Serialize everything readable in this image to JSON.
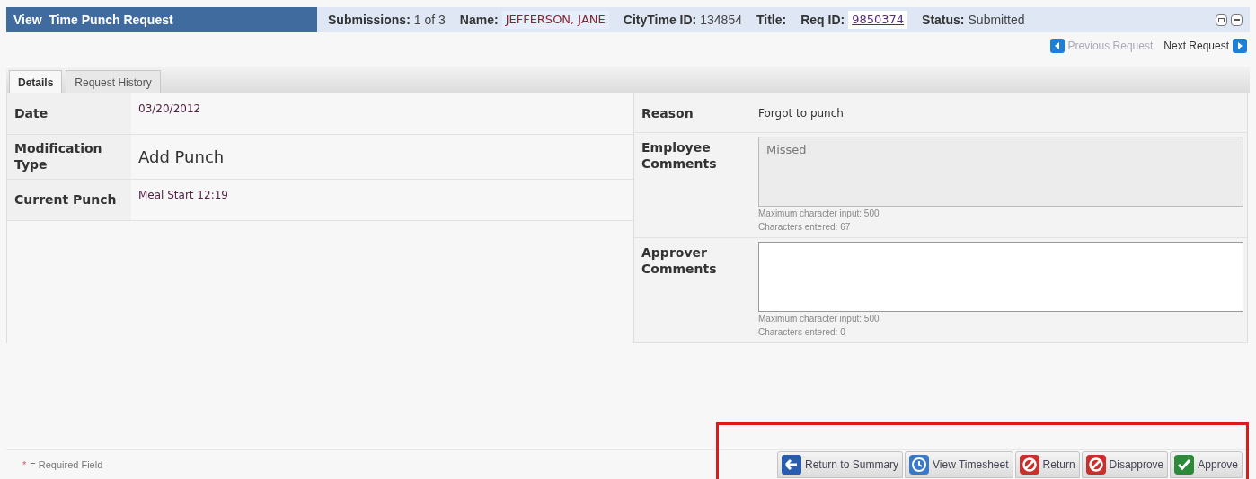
{
  "header": {
    "title": "View  Time Punch Request",
    "fields": [
      {
        "label": "Submissions:",
        "value": "1 of 3",
        "kind": "plain"
      },
      {
        "label": "Name:",
        "value": "JEFFERSON, JANE",
        "kind": "name"
      },
      {
        "label": "CityTime ID:",
        "value": "134854",
        "kind": "plain"
      },
      {
        "label": "Title:",
        "kind": "plain"
      },
      {
        "label": "Req ID:",
        "value": "9850374",
        "kind": "link"
      },
      {
        "label": "Status:",
        "value": "Submitted",
        "kind": "plain"
      }
    ]
  },
  "nav": {
    "previous": {
      "label": "Previous Request",
      "disabled": true
    },
    "next": {
      "label": "Next Request",
      "disabled": false
    }
  },
  "tabs": [
    {
      "label": "Details",
      "selected": true
    },
    {
      "label": "Request History",
      "selected": false
    }
  ],
  "details": [
    {
      "label": "Date",
      "value": "03/20/2012",
      "kind": "small"
    },
    {
      "label": "Modification Type",
      "value": "Add Punch",
      "kind": "large"
    },
    {
      "label": "Current Punch",
      "value": "Meal Start 12:19",
      "kind": "small"
    }
  ],
  "reason": {
    "label": "Reason",
    "value": "Forgot to punch"
  },
  "comments": [
    {
      "label": "Employee Comments",
      "value": "Missed",
      "max_note": "Maximum character input: 500",
      "count_note": "Characters entered: 67",
      "disabled": true
    },
    {
      "label": "Approver Comments",
      "max_note": "Maximum character input: 500",
      "count_note": "Characters entered: 0",
      "disabled": false
    }
  ],
  "required_note": {
    "mark": "*",
    "text": "= Required Field"
  },
  "actions": [
    {
      "label": "Return to Summary",
      "kind": "back"
    },
    {
      "label": "View Timesheet",
      "kind": "clock"
    },
    {
      "label": "Return",
      "kind": "stop"
    },
    {
      "label": "Disapprove",
      "kind": "stop"
    },
    {
      "label": "Approve",
      "kind": "check"
    }
  ]
}
